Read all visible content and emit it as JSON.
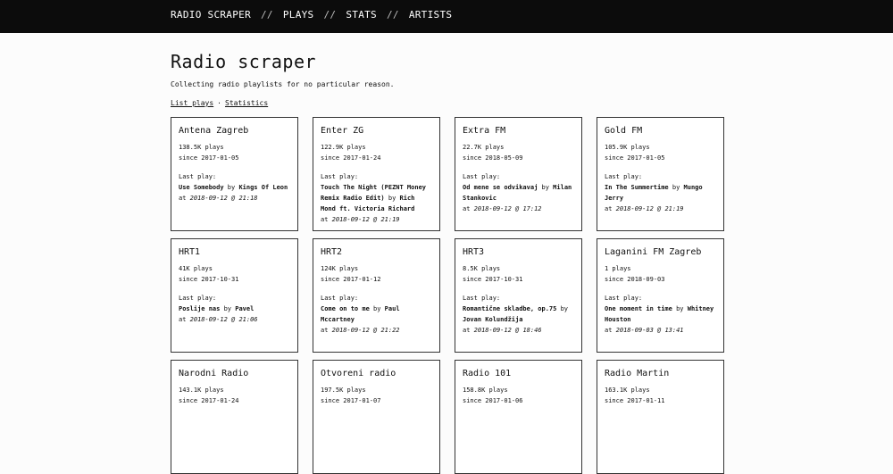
{
  "nav": {
    "items": [
      "RADIO SCRAPER",
      "PLAYS",
      "STATS",
      "ARTISTS"
    ],
    "separator": "//"
  },
  "page": {
    "title": "Radio scraper",
    "tagline": "Collecting radio playlists for no particular reason.",
    "links": [
      "List plays",
      "Statistics"
    ],
    "link_separator": "·"
  },
  "labels": {
    "last_play": "Last play:",
    "by": "by",
    "at": "at"
  },
  "stations": [
    {
      "name": "Antena Zagreb",
      "plays": "138.5K plays",
      "since": "since 2017-01-05",
      "song": "Use Somebody",
      "artist": "Kings Of Leon",
      "time": "2018-09-12 @ 21:18"
    },
    {
      "name": "Enter ZG",
      "plays": "122.9K plays",
      "since": "since 2017-01-24",
      "song": "Touch The Night (PEZNT Money Remix Radio Edit)",
      "artist": "Rich Mond ft. Victoria Richard",
      "time": "2018-09-12 @ 21:19"
    },
    {
      "name": "Extra FM",
      "plays": "22.7K plays",
      "since": "since 2018-05-09",
      "song": "Od mene se odvikavaj",
      "artist": "Milan Stankovic",
      "time": "2018-09-12 @ 17:12"
    },
    {
      "name": "Gold FM",
      "plays": "105.9K plays",
      "since": "since 2017-01-05",
      "song": "In The Summertime",
      "artist": "Mungo Jerry",
      "time": "2018-09-12 @ 21:19"
    },
    {
      "name": "HRT1",
      "plays": "41K plays",
      "since": "since 2017-10-31",
      "song": "Poslije nas",
      "artist": "Pavel",
      "time": "2018-09-12 @ 21:06"
    },
    {
      "name": "HRT2",
      "plays": "124K plays",
      "since": "since 2017-01-12",
      "song": "Come on to me",
      "artist": "Paul Mccartney",
      "time": "2018-09-12 @ 21:22"
    },
    {
      "name": "HRT3",
      "plays": "8.5K plays",
      "since": "since 2017-10-31",
      "song": "Romantične skladbe, op.75",
      "artist": "Jovan Kolundžija",
      "time": "2018-09-12 @ 18:46"
    },
    {
      "name": "Laganini FM Zagreb",
      "plays": "1 plays",
      "since": "since 2018-09-03",
      "song": "One moment in time",
      "artist": "Whitney Houston",
      "time": "2018-09-03 @ 13:41"
    },
    {
      "name": "Narodni Radio",
      "plays": "143.1K plays",
      "since": "since 2017-01-24"
    },
    {
      "name": "Otvoreni radio",
      "plays": "197.5K plays",
      "since": "since 2017-01-07"
    },
    {
      "name": "Radio 101",
      "plays": "158.8K plays",
      "since": "since 2017-01-06"
    },
    {
      "name": "Radio Martin",
      "plays": "163.1K plays",
      "since": "since 2017-01-11"
    }
  ]
}
